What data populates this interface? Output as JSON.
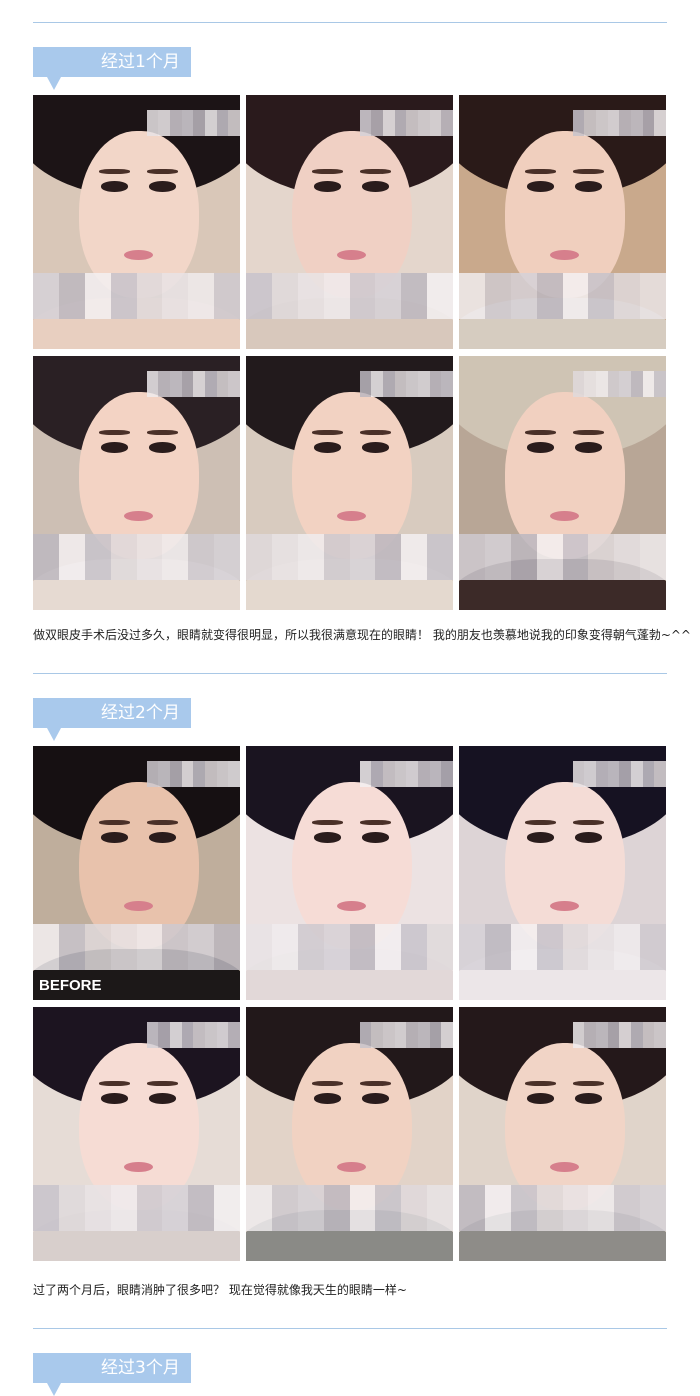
{
  "sections": [
    {
      "tag": "经过1个月",
      "caption": "做双眼皮手术后没过多久，眼睛就变得很明显，所以我很满意现在的眼睛！ 我的朋友也羡慕地说我的印象变得朝气蓬勃~^^"
    },
    {
      "tag": "经过2个月",
      "caption": "过了两个月后，眼睛消肿了很多吧？ 现在觉得就像我天生的眼睛一样~",
      "before_label": "BEFORE"
    },
    {
      "tag": "经过3个月"
    }
  ]
}
